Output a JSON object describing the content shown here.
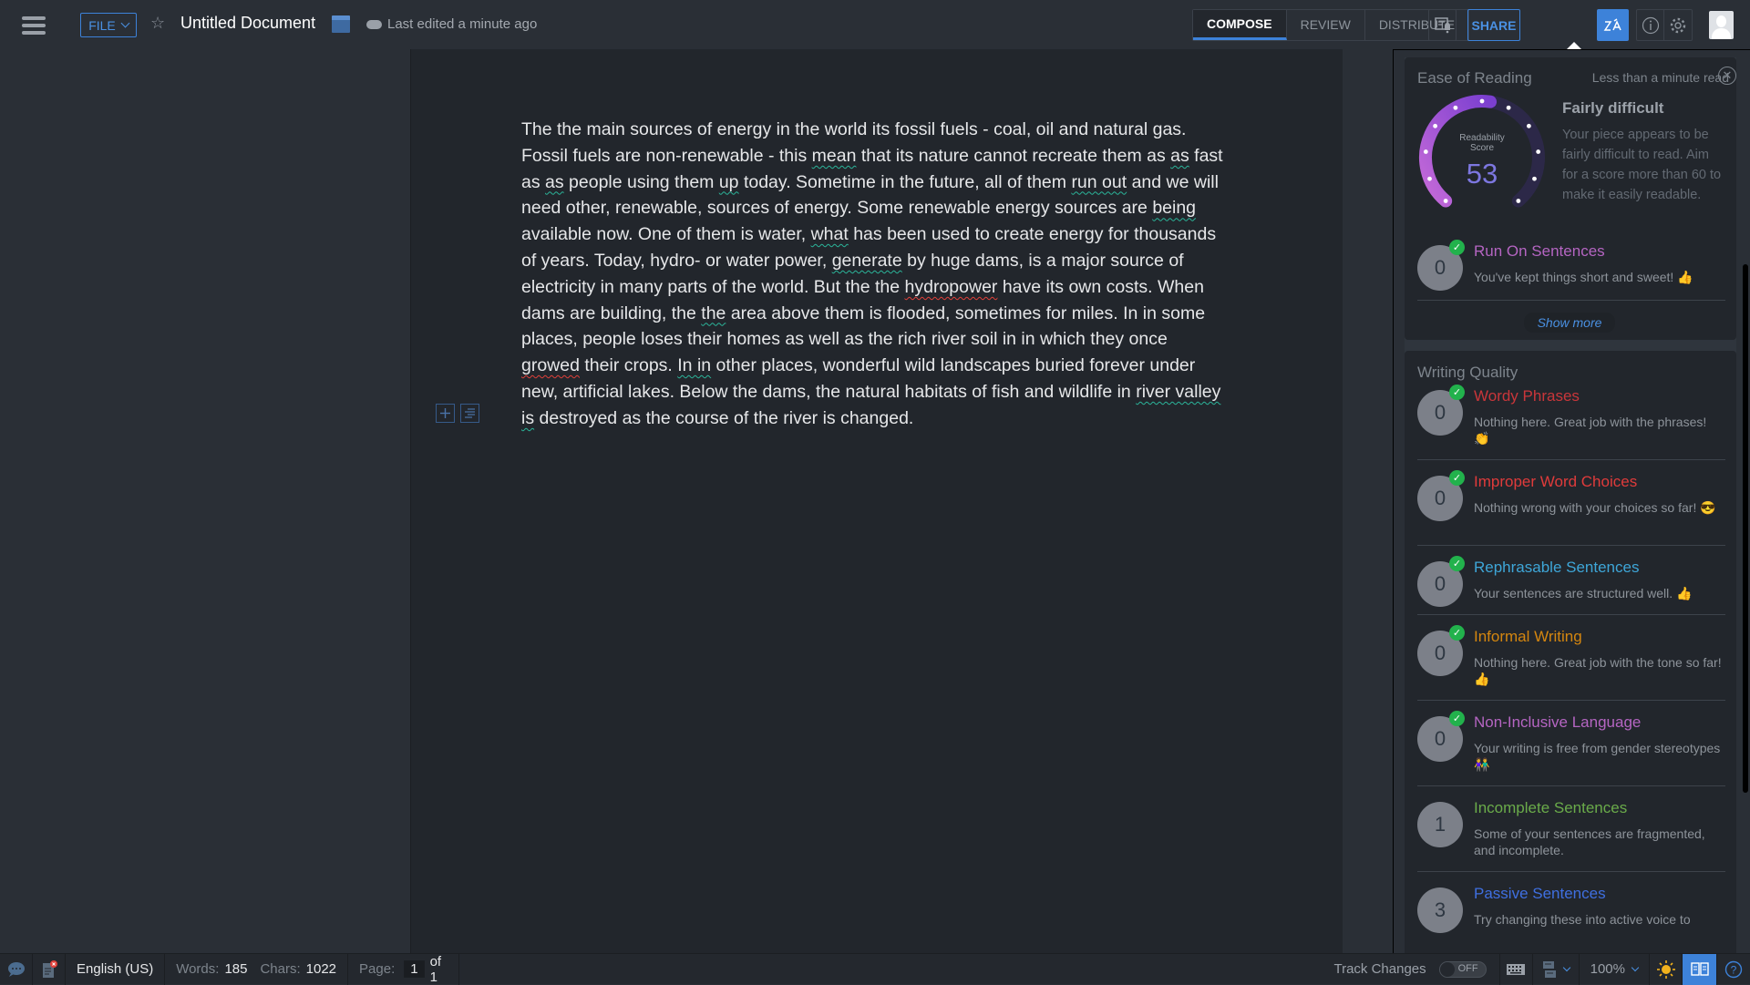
{
  "header": {
    "file_label": "FILE",
    "doc_title": "Untitled Document",
    "last_edited": "Last edited a minute ago",
    "modes": [
      "COMPOSE",
      "REVIEW",
      "DISTRIBUTE"
    ],
    "active_mode": "COMPOSE",
    "share_label": "SHARE",
    "zia_label": "Zia",
    "accent_color": "#3d82d9"
  },
  "document": {
    "segments": [
      {
        "t": "The the main sources of energy in the world its fossil fuels - coal, oil and natural gas. Fossil fuels are non-renewable - this "
      },
      {
        "t": "mean",
        "mark": "grammar"
      },
      {
        "t": " that its nature cannot recreate them as "
      },
      {
        "t": "as",
        "mark": "grammar"
      },
      {
        "t": " fast as "
      },
      {
        "t": "as",
        "mark": "grammar"
      },
      {
        "t": " people using them "
      },
      {
        "t": "up",
        "mark": "grammar"
      },
      {
        "t": " today. Sometime in the future, all of them "
      },
      {
        "t": "run out",
        "mark": "grammar"
      },
      {
        "t": " and we will need other, renewable, sources of energy. Some renewable energy sources are "
      },
      {
        "t": "being",
        "mark": "grammar"
      },
      {
        "t": " available now. One of them is water, "
      },
      {
        "t": "what",
        "mark": "grammar"
      },
      {
        "t": " has been used to create energy for thousands of years. Today, hydro- or water power, "
      },
      {
        "t": "generate",
        "mark": "grammar"
      },
      {
        "t": " by huge dams, is a major source of electricity in many parts of the world. But the the "
      },
      {
        "t": "hydropower",
        "mark": "spelling"
      },
      {
        "t": " have its own costs. When dams are building, the "
      },
      {
        "t": "the",
        "mark": "grammar"
      },
      {
        "t": " area above them is flooded, sometimes for miles. In in some places, people loses their homes as well as the rich river soil in in which they once "
      },
      {
        "t": "growed",
        "mark": "spelling"
      },
      {
        "t": " their crops. "
      },
      {
        "t": "In in",
        "mark": "grammar"
      },
      {
        "t": " other places, wonderful wild landscapes buried forever under new, artificial lakes. Below the dams, the natural habitats of fish and wildlife in "
      },
      {
        "t": "river valley",
        "mark": "grammar"
      },
      {
        "t": " "
      },
      {
        "t": "is",
        "mark": "grammar"
      },
      {
        "t": " destroyed as the course of the river is changed."
      }
    ],
    "grammar_color": "#2bb59a",
    "spelling_color": "#e0403a"
  },
  "panel": {
    "ease": {
      "title": "Ease of Reading",
      "read_time": "Less than a minute read",
      "gauge_label_1": "Readability",
      "gauge_label_2": "Score",
      "score": 53,
      "score_max": 100,
      "level": "Fairly difficult",
      "description": "Your piece appears to be fairly difficult to read. Aim for a score more than 60 to make it easily readable."
    },
    "run_on": {
      "count": "0",
      "title": "Run On Sentences",
      "desc": "You've kept things short and sweet! 👍",
      "color": "#b565c2",
      "passed": true
    },
    "show_more": "Show more",
    "quality_title": "Writing Quality",
    "quality": [
      {
        "count": "0",
        "title": "Wordy Phrases",
        "desc": "Nothing here. Great job with the phrases! 👏",
        "color": "#c9363a",
        "passed": true
      },
      {
        "count": "0",
        "title": "Improper Word Choices",
        "desc": "Nothing wrong with your choices so far! 😎",
        "color": "#e03b3b",
        "passed": true
      },
      {
        "count": "0",
        "title": "Rephrasable Sentences",
        "desc": "Your sentences are structured well. 👍",
        "color": "#3ea6d8",
        "passed": true
      },
      {
        "count": "0",
        "title": "Informal Writing",
        "desc": "Nothing here. Great job with the tone so far! 👍",
        "color": "#d4860f",
        "passed": true
      },
      {
        "count": "0",
        "title": "Non-Inclusive Language",
        "desc": "Your writing is free from gender stereotypes 👫",
        "color": "#b565c2",
        "passed": true
      },
      {
        "count": "1",
        "title": "Incomplete Sentences",
        "desc": "Some of your sentences are fragmented, and incomplete.",
        "color": "#6aab4a",
        "passed": false
      },
      {
        "count": "3",
        "title": "Passive Sentences",
        "desc": "Try changing these into active voice to",
        "color": "#3f6fe0",
        "passed": false
      }
    ]
  },
  "status": {
    "language": "English (US)",
    "words_label": "Words:",
    "words": "185",
    "chars_label": "Chars:",
    "chars": "1022",
    "page_label": "Page:",
    "page": "1",
    "page_of": "of 1",
    "track_changes": "Track Changes",
    "track_state": "OFF",
    "zoom": "100%"
  }
}
